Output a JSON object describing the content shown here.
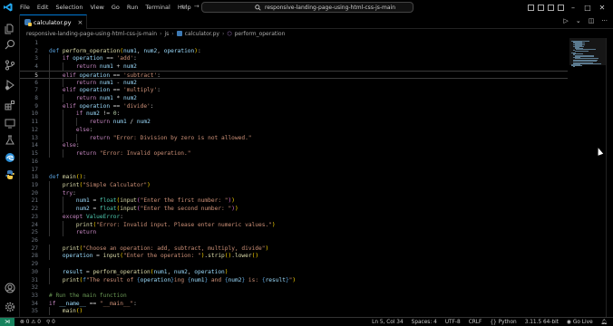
{
  "titlebar": {
    "menu": [
      "File",
      "Edit",
      "Selection",
      "View",
      "Go",
      "Run",
      "Terminal",
      "Help"
    ],
    "search_text": "responsive-landing-page-using-html-css-js-main"
  },
  "tab": {
    "label": "calculator.py",
    "close": "×"
  },
  "breadcrumb": {
    "folder": "responsive-landing-page-using-html-css-js-main",
    "subfolder": "js",
    "file": "calculator.py",
    "symbol": "perform_operation"
  },
  "editor": {
    "current_line": 5,
    "lines": [
      {
        "n": "1",
        "html": ""
      },
      {
        "n": "2",
        "html": "<span class='kwb'>def</span> <span class='fn'>perform_operation</span><span class='br'>(</span><span class='var'>num1</span>, <span class='var'>num2</span>, <span class='var'>operation</span><span class='br'>)</span>:"
      },
      {
        "n": "3",
        "html": "    <span class='kw'>if</span> <span class='var'>operation</span> == <span class='str'>'add'</span>:"
      },
      {
        "n": "4",
        "html": "        <span class='kw'>return</span> <span class='var'>num1</span> + <span class='var'>num2</span>"
      },
      {
        "n": "5",
        "html": "    <span class='kw'>elif</span> <span class='var'>operation</span> == <span class='str'>'subtract'</span>:"
      },
      {
        "n": "6",
        "html": "        <span class='kw'>return</span> <span class='var'>num1</span> - <span class='var'>num2</span>"
      },
      {
        "n": "7",
        "html": "    <span class='kw'>elif</span> <span class='var'>operation</span> == <span class='str'>'multiply'</span>:"
      },
      {
        "n": "8",
        "html": "        <span class='kw'>return</span> <span class='var'>num1</span> * <span class='var'>num2</span>"
      },
      {
        "n": "9",
        "html": "    <span class='kw'>elif</span> <span class='var'>operation</span> == <span class='str'>'divide'</span>:"
      },
      {
        "n": "10",
        "html": "        <span class='kw'>if</span> <span class='var'>num2</span> != <span class='num'>0</span>:"
      },
      {
        "n": "11",
        "html": "            <span class='kw'>return</span> <span class='var'>num1</span> / <span class='var'>num2</span>"
      },
      {
        "n": "12",
        "html": "        <span class='kw'>else</span>:"
      },
      {
        "n": "13",
        "html": "            <span class='kw'>return</span> <span class='str'>\"Error: Division by zero is not allowed.\"</span>"
      },
      {
        "n": "14",
        "html": "    <span class='kw'>else</span>:"
      },
      {
        "n": "15",
        "html": "        <span class='kw'>return</span> <span class='str'>\"Error: Invalid operation.\"</span>"
      },
      {
        "n": "16",
        "html": ""
      },
      {
        "n": "17",
        "html": ""
      },
      {
        "n": "18",
        "html": "<span class='kwb'>def</span> <span class='fn'>main</span><span class='br'>()</span>:"
      },
      {
        "n": "19",
        "html": "    <span class='fn'>print</span><span class='br'>(</span><span class='str'>\"Simple Calculator\"</span><span class='br'>)</span>"
      },
      {
        "n": "20",
        "html": "    <span class='kw'>try</span>:"
      },
      {
        "n": "21",
        "html": "        <span class='var'>num1</span> = <span class='cls'>float</span><span class='br'>(</span><span class='fn'>input</span><span class='br2'>(</span><span class='str'>\"Enter the first number: \"</span><span class='br2'>)</span><span class='br'>)</span>"
      },
      {
        "n": "22",
        "html": "        <span class='var'>num2</span> = <span class='cls'>float</span><span class='br'>(</span><span class='fn'>input</span><span class='br2'>(</span><span class='str'>\"Enter the second number: \"</span><span class='br2'>)</span><span class='br'>)</span>"
      },
      {
        "n": "23",
        "html": "    <span class='kw'>except</span> <span class='cls'>ValueError</span>:"
      },
      {
        "n": "24",
        "html": "        <span class='fn'>print</span><span class='br'>(</span><span class='str'>\"Error: Invalid input. Please enter numeric values.\"</span><span class='br'>)</span>"
      },
      {
        "n": "25",
        "html": "        <span class='kw'>return</span>"
      },
      {
        "n": "26",
        "html": ""
      },
      {
        "n": "27",
        "html": "    <span class='fn'>print</span><span class='br'>(</span><span class='str'>\"Choose an operation: add, subtract, multiply, divide\"</span><span class='br'>)</span>"
      },
      {
        "n": "28",
        "html": "    <span class='var'>operation</span> = <span class='fn'>input</span><span class='br'>(</span><span class='str'>\"Enter the operation: \"</span><span class='br'>)</span>.<span class='fn'>strip</span><span class='br'>()</span>.<span class='fn'>lower</span><span class='br'>()</span>"
      },
      {
        "n": "29",
        "html": ""
      },
      {
        "n": "30",
        "html": "    <span class='var'>result</span> = <span class='fn'>perform_operation</span><span class='br'>(</span><span class='var'>num1</span>, <span class='var'>num2</span>, <span class='var'>operation</span><span class='br'>)</span>"
      },
      {
        "n": "31",
        "html": "    <span class='fn'>print</span><span class='br'>(</span><span class='kwb'>f</span><span class='str'>\"The result of </span><span class='kwb'>{</span><span class='var'>operation</span><span class='kwb'>}</span><span class='str'>ing </span><span class='kwb'>{</span><span class='var'>num1</span><span class='kwb'>}</span><span class='str'> and </span><span class='kwb'>{</span><span class='var'>num2</span><span class='kwb'>}</span><span class='str'> is: </span><span class='kwb'>{</span><span class='var'>result</span><span class='kwb'>}</span><span class='str'>\"</span><span class='br'>)</span>"
      },
      {
        "n": "32",
        "html": ""
      },
      {
        "n": "33",
        "html": "<span class='cm'># Run the main function</span>"
      },
      {
        "n": "34",
        "html": "<span class='kw'>if</span> <span class='var'>__name__</span> == <span class='str'>\"__main__\"</span>:"
      },
      {
        "n": "35",
        "html": "    <span class='fn'>main</span><span class='br'>()</span>"
      }
    ]
  },
  "status": {
    "errors": "0",
    "warnings": "0",
    "sync": "0",
    "position": "Ln 5, Col 34",
    "spaces": "Spaces: 4",
    "encoding": "UTF-8",
    "eol": "CRLF",
    "language": "Python",
    "interpreter": "3.11.5 64-bit",
    "golive": "Go Live"
  },
  "icons": [
    "explorer-icon",
    "search-icon",
    "source-control-icon",
    "run-debug-icon",
    "extensions-icon",
    "remote-explorer-icon",
    "testing-icon",
    "edge-tools-icon",
    "python-icon",
    "accounts-icon",
    "settings-gear-icon"
  ]
}
